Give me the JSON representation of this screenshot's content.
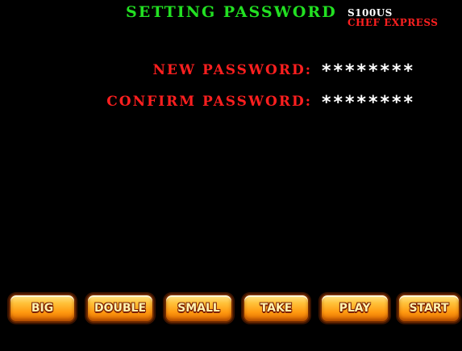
{
  "header": {
    "title": "SETTING PASSWORD",
    "model": "S100US",
    "game_name": "CHEF EXPRESS"
  },
  "form": {
    "new_password_label": "NEW PASSWORD:",
    "new_password_value": "********",
    "confirm_password_label": "CONFIRM PASSWORD:",
    "confirm_password_value": "********"
  },
  "buttons": {
    "big": "BIG",
    "double": "DOUBLE",
    "small": "SMALL",
    "take": "TAKE",
    "play": "PLAY",
    "start": "START"
  },
  "colors": {
    "title": "#22e022",
    "label": "#ff1f1f",
    "value": "#ffffff",
    "button": "#ff9a10"
  }
}
